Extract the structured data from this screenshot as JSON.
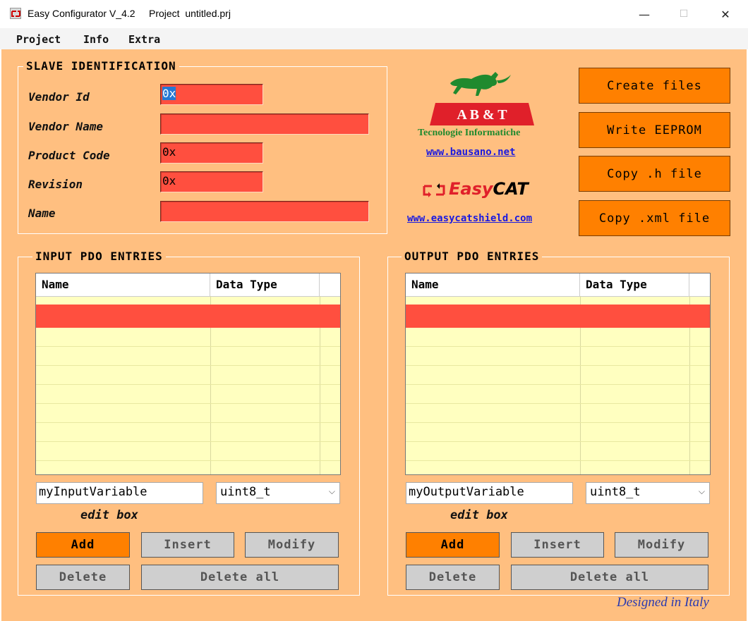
{
  "window": {
    "title": "Easy Configurator V_4.2     Project  untitled.prj",
    "minimize": "—",
    "maximize": "☐",
    "close": "✕"
  },
  "menu": {
    "items": [
      "Project",
      "Info",
      "Extra"
    ]
  },
  "slave_identification": {
    "title": "SLAVE IDENTIFICATION",
    "fields": [
      {
        "label": "Vendor Id",
        "value": "0x"
      },
      {
        "label": "Vendor Name",
        "value": ""
      },
      {
        "label": "Product Code",
        "value": "0x"
      },
      {
        "label": "Revision",
        "value": "0x"
      },
      {
        "label": "Name",
        "value": ""
      }
    ]
  },
  "branding": {
    "abt_logo": "A B & T",
    "abt_subtitle": "Tecnologie Informatiche",
    "bausano_link": "www.bausano.net",
    "easycat_logo_a": "Easy",
    "easycat_logo_b": "CAT",
    "easycat_link": "www.easycatshield.com"
  },
  "actions": {
    "create_files": "Create files",
    "write_eeprom": "Write EEPROM",
    "copy_h": "Copy .h file",
    "copy_xml": "Copy .xml file"
  },
  "input_pdo": {
    "title": "INPUT PDO ENTRIES",
    "columns": [
      "Name",
      "Data Type"
    ],
    "edit_value": "myInputVariable",
    "type_value": "uint8_t",
    "edit_label": "edit box",
    "buttons": {
      "add": "Add",
      "insert": "Insert",
      "modify": "Modify",
      "delete": "Delete",
      "delete_all": "Delete all"
    }
  },
  "output_pdo": {
    "title": "OUTPUT PDO ENTRIES",
    "columns": [
      "Name",
      "Data Type"
    ],
    "edit_value": "myOutputVariable",
    "type_value": "uint8_t",
    "edit_label": "edit box",
    "buttons": {
      "add": "Add",
      "insert": "Insert",
      "modify": "Modify",
      "delete": "Delete",
      "delete_all": "Delete all"
    }
  },
  "footer": {
    "designed": "Designed in Italy"
  },
  "colors": {
    "panel": "#ffbf80",
    "field_red": "#ff4f3f",
    "accent_orange": "#ff8000",
    "grid_yellow": "#ffffc0"
  }
}
